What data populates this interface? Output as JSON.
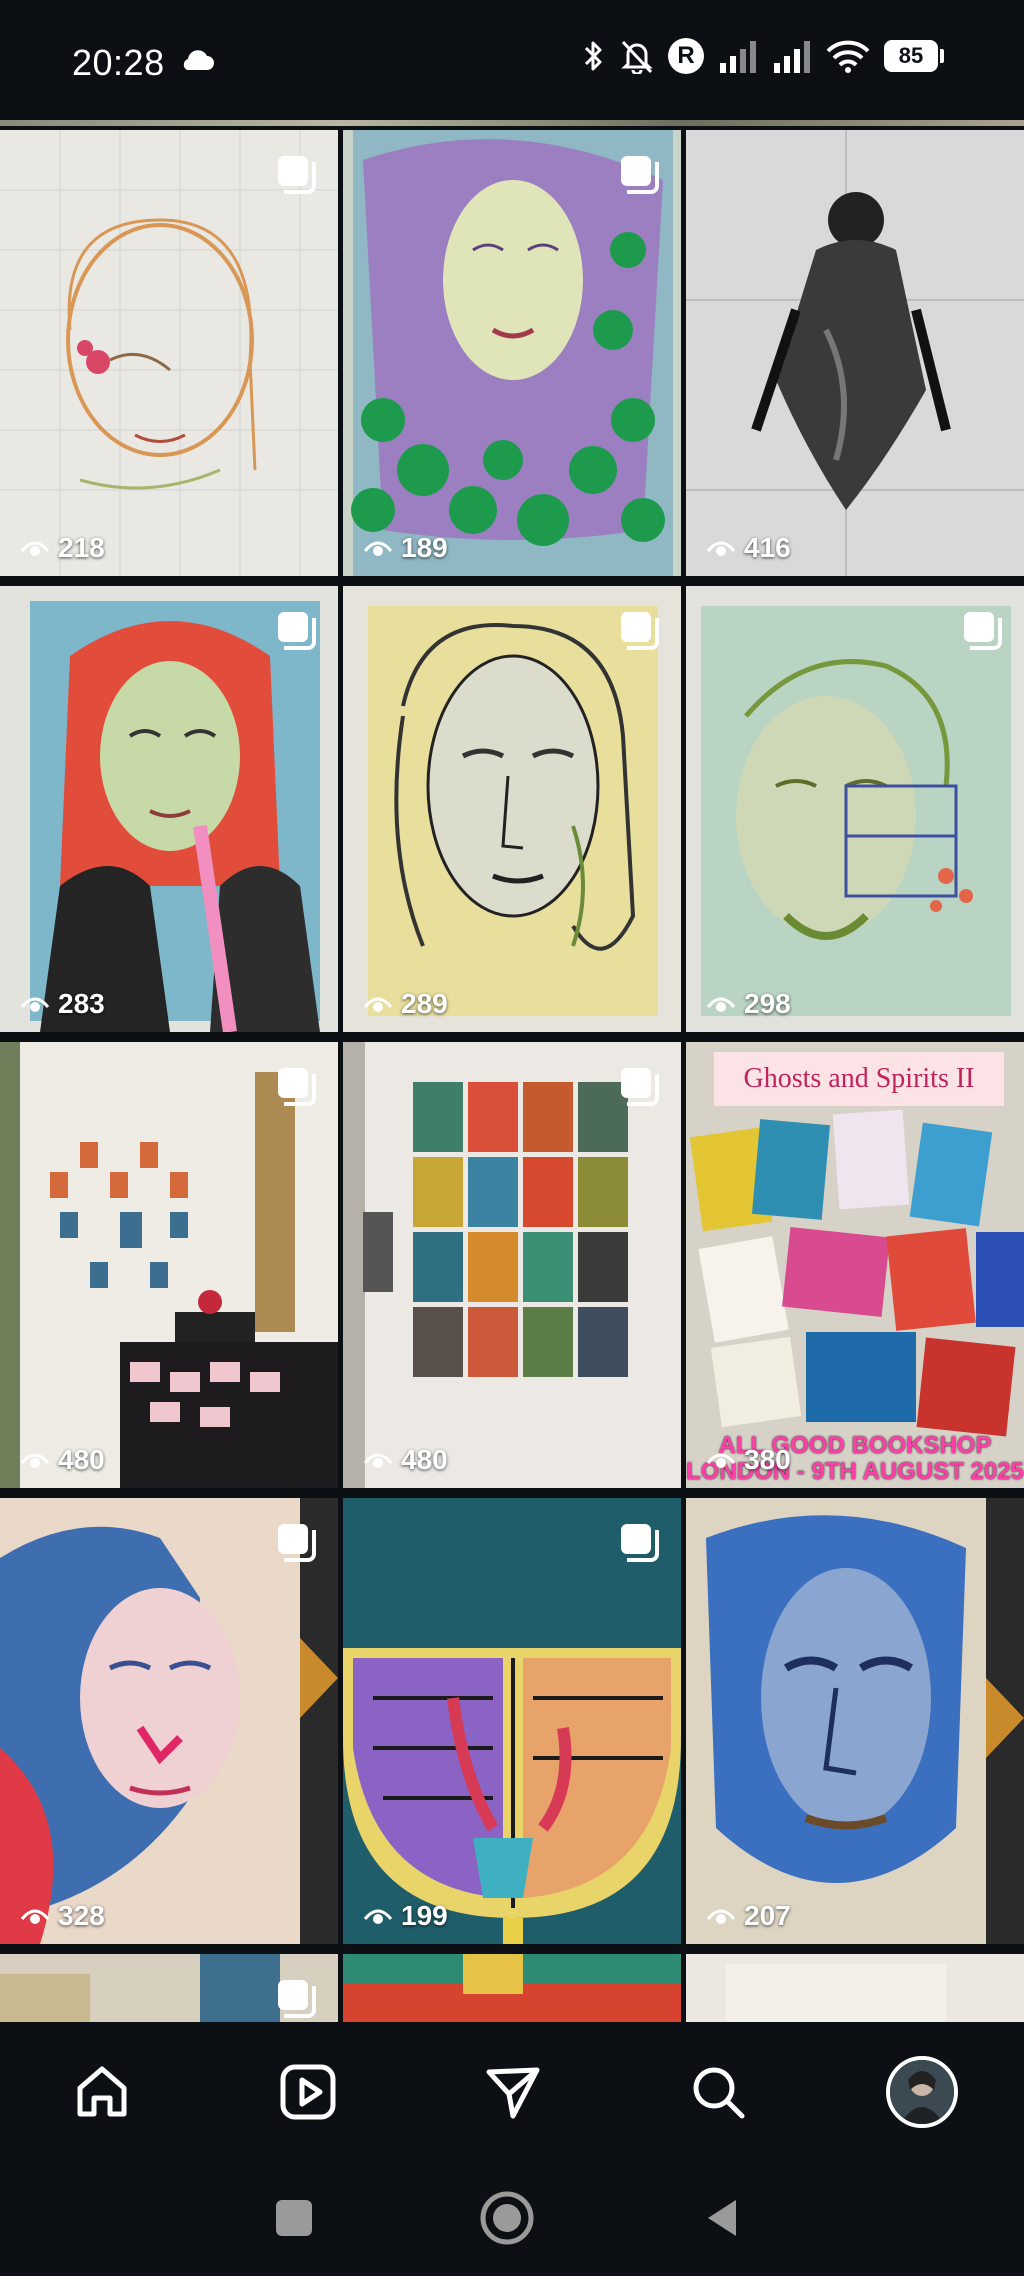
{
  "status_bar": {
    "time": "20:28",
    "battery": "85",
    "carrier_badge": "R",
    "icons": [
      "cloud-icon",
      "bluetooth-icon",
      "bell-off-icon",
      "carrier-r-icon",
      "signal-icon",
      "signal-icon",
      "wifi-icon",
      "battery-icon"
    ]
  },
  "grid": {
    "tiles": [
      {
        "views": "218"
      },
      {
        "views": "189"
      },
      {
        "views": "416"
      },
      {
        "views": "283"
      },
      {
        "views": "289"
      },
      {
        "views": "298"
      },
      {
        "views": "480"
      },
      {
        "views": "480"
      },
      {
        "views": "380",
        "poster_title": "Ghosts and Spirits II",
        "poster_caption_1": "ALL GOOD BOOKSHOP",
        "poster_caption_2": "LONDON - 9TH AUGUST 2025"
      },
      {
        "views": "328"
      },
      {
        "views": "199"
      },
      {
        "views": "207"
      }
    ]
  },
  "bottom_nav": {
    "items": [
      "home-icon",
      "reels-icon",
      "direct-messages-icon",
      "search-icon",
      "profile-avatar"
    ]
  },
  "android_nav": {
    "items": [
      "recents-icon",
      "home-circle-icon",
      "back-icon"
    ]
  },
  "colors": {
    "background": "#0c0f14",
    "poster_pink": "#ff3fa8"
  }
}
